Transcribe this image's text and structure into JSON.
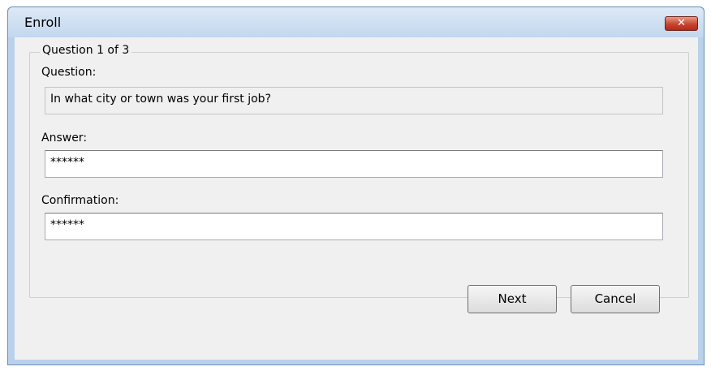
{
  "window": {
    "title": "Enroll",
    "close_glyph": "✕"
  },
  "group": {
    "legend": "Question 1 of 3"
  },
  "question": {
    "label": "Question:",
    "value": "In what city or town was your first job?"
  },
  "answer": {
    "label": "Answer:",
    "value": "******"
  },
  "confirmation": {
    "label": "Confirmation:",
    "value": "******"
  },
  "buttons": {
    "next": "Next",
    "cancel": "Cancel"
  },
  "colors": {
    "titlebar": "#c2d7ee",
    "close_button": "#c8452f",
    "dialog_background": "#f0f0f0"
  }
}
